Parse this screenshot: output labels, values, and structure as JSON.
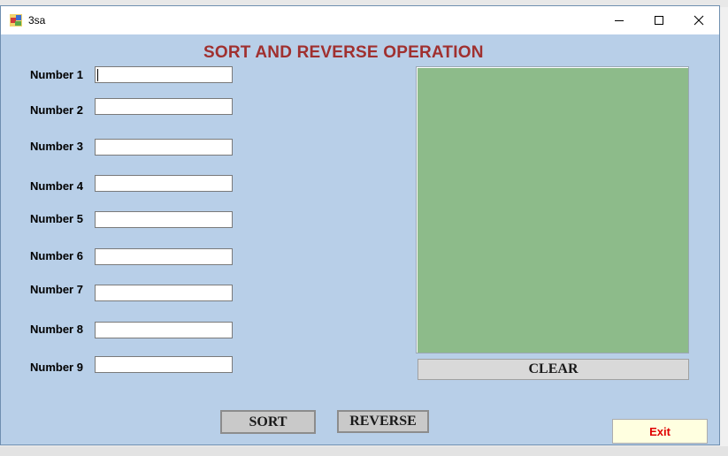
{
  "window": {
    "title": "3sa",
    "minimize": "—",
    "maximize": "☐",
    "close": "✕"
  },
  "heading": "SORT AND REVERSE OPERATION",
  "numbers": [
    {
      "label": "Number 1",
      "value": ""
    },
    {
      "label": "Number 2",
      "value": ""
    },
    {
      "label": "Number 3",
      "value": ""
    },
    {
      "label": "Number 4",
      "value": ""
    },
    {
      "label": "Number 5",
      "value": ""
    },
    {
      "label": "Number 6",
      "value": ""
    },
    {
      "label": "Number 7",
      "value": ""
    },
    {
      "label": "Number 8",
      "value": ""
    },
    {
      "label": "Number 9",
      "value": ""
    }
  ],
  "output_panel": {
    "color": "#8dbb8a"
  },
  "buttons": {
    "clear": "CLEAR",
    "sort": "SORT",
    "reverse": "REVERSE",
    "exit": "Exit"
  },
  "colors": {
    "form_background": "#b8cfe8",
    "heading": "#a0302f",
    "exit_text": "#e00000"
  }
}
